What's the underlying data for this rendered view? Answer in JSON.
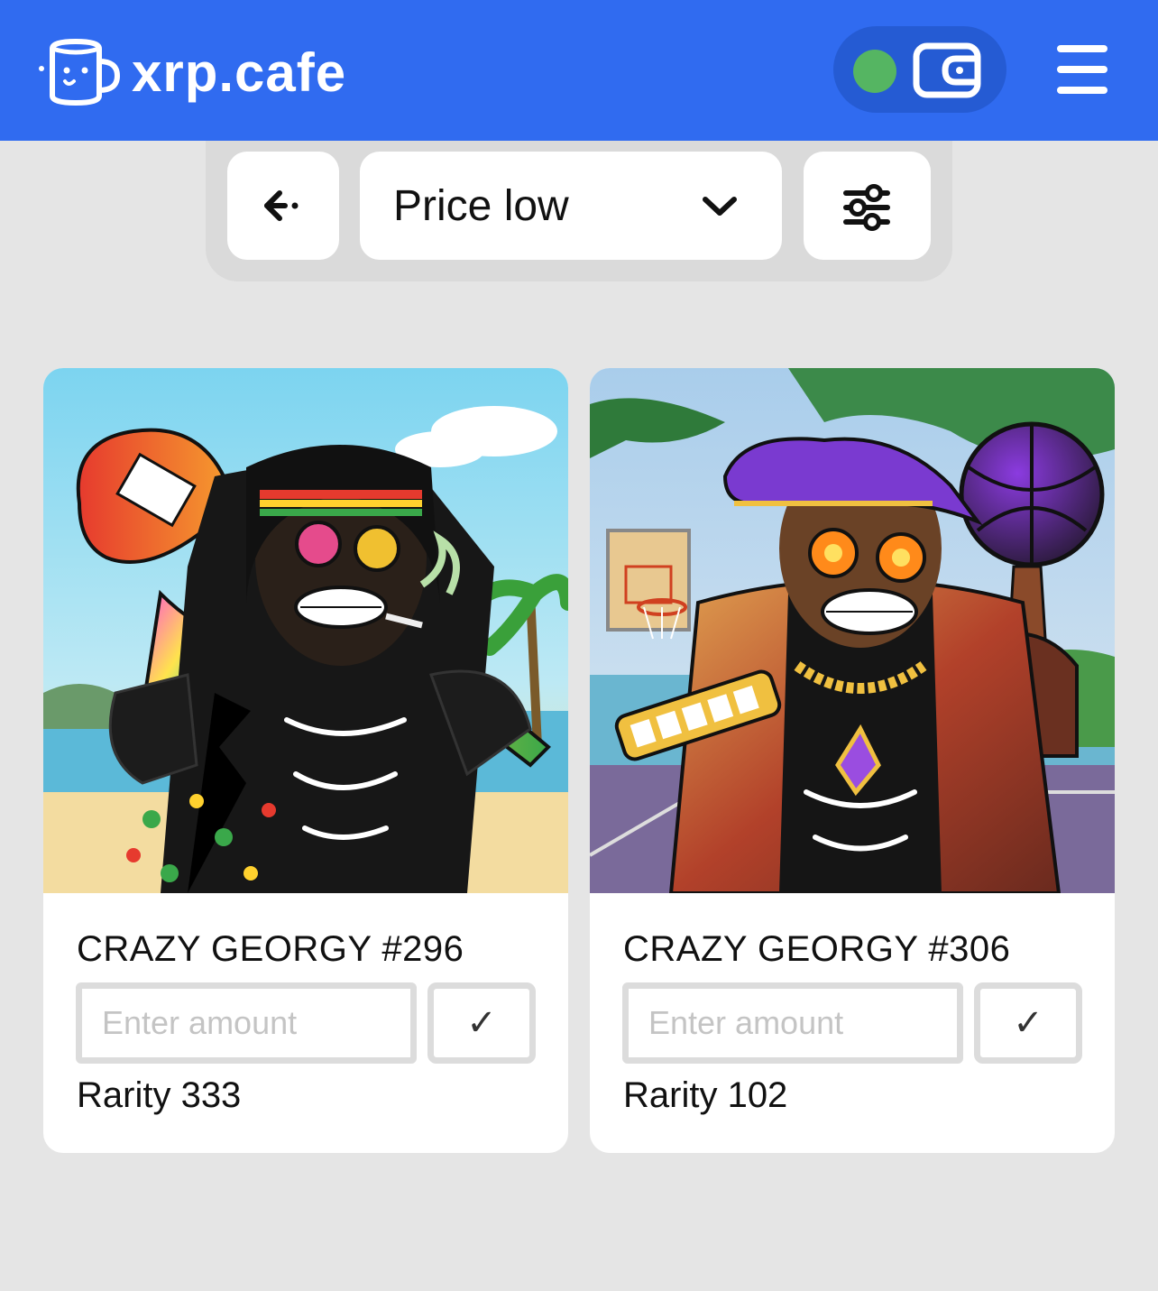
{
  "header": {
    "brand": "xrp.cafe",
    "status_color": "#55b562",
    "brand_color": "#306bf0"
  },
  "toolbar": {
    "back_icon": "arrow-left-icon",
    "sort_label": "Price low",
    "filter_icon": "sliders-icon"
  },
  "cards": [
    {
      "title": "CRAZY GEORGY #296",
      "placeholder": "Enter amount",
      "confirm_label": "✓",
      "rarity": "Rarity 333"
    },
    {
      "title": "CRAZY GEORGY #306",
      "placeholder": "Enter amount",
      "confirm_label": "✓",
      "rarity": "Rarity 102"
    }
  ]
}
